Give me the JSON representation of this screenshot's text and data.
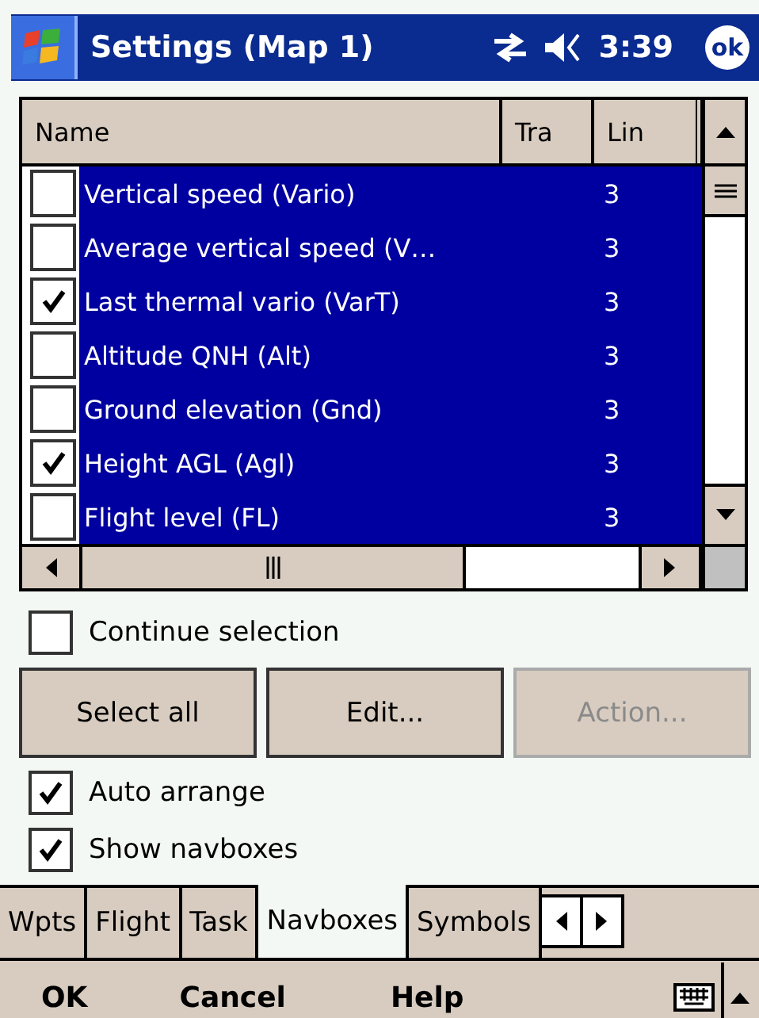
{
  "title_bar": {
    "title": "Settings (Map 1)",
    "time": "3:39",
    "ok": "ok"
  },
  "list": {
    "columns": [
      "Name",
      "Tra",
      "Lin"
    ],
    "rows": [
      {
        "name": "Vertical speed (Vario)",
        "tra": "",
        "lin": "3",
        "checked": false,
        "selected": true
      },
      {
        "name": "Average vertical speed (V…",
        "tra": "",
        "lin": "3",
        "checked": false,
        "selected": true
      },
      {
        "name": "Last thermal vario (VarT)",
        "tra": "",
        "lin": "3",
        "checked": true,
        "selected": true
      },
      {
        "name": "Altitude QNH (Alt)",
        "tra": "",
        "lin": "3",
        "checked": false,
        "selected": true
      },
      {
        "name": "Ground elevation (Gnd)",
        "tra": "",
        "lin": "3",
        "checked": false,
        "selected": true
      },
      {
        "name": "Height AGL (Agl)",
        "tra": "",
        "lin": "3",
        "checked": true,
        "selected": true
      },
      {
        "name": "Flight level (FL)",
        "tra": "",
        "lin": "3",
        "checked": false,
        "selected": true
      }
    ]
  },
  "continue_selection": {
    "label": "Continue selection",
    "checked": false
  },
  "buttons": [
    {
      "label": "Select all",
      "disabled": false
    },
    {
      "label": "Edit...",
      "disabled": false
    },
    {
      "label": "Action...",
      "disabled": true
    }
  ],
  "options": [
    {
      "label": "Auto arrange",
      "checked": true
    },
    {
      "label": "Show navboxes",
      "checked": true
    }
  ],
  "tabs": [
    {
      "label": "Wpts",
      "selected": false
    },
    {
      "label": "Flight",
      "selected": false
    },
    {
      "label": "Task",
      "selected": false
    },
    {
      "label": "Navboxes",
      "selected": true
    },
    {
      "label": "Symbols",
      "selected": false
    }
  ],
  "menu_bar": [
    "OK",
    "Cancel",
    "Help"
  ]
}
